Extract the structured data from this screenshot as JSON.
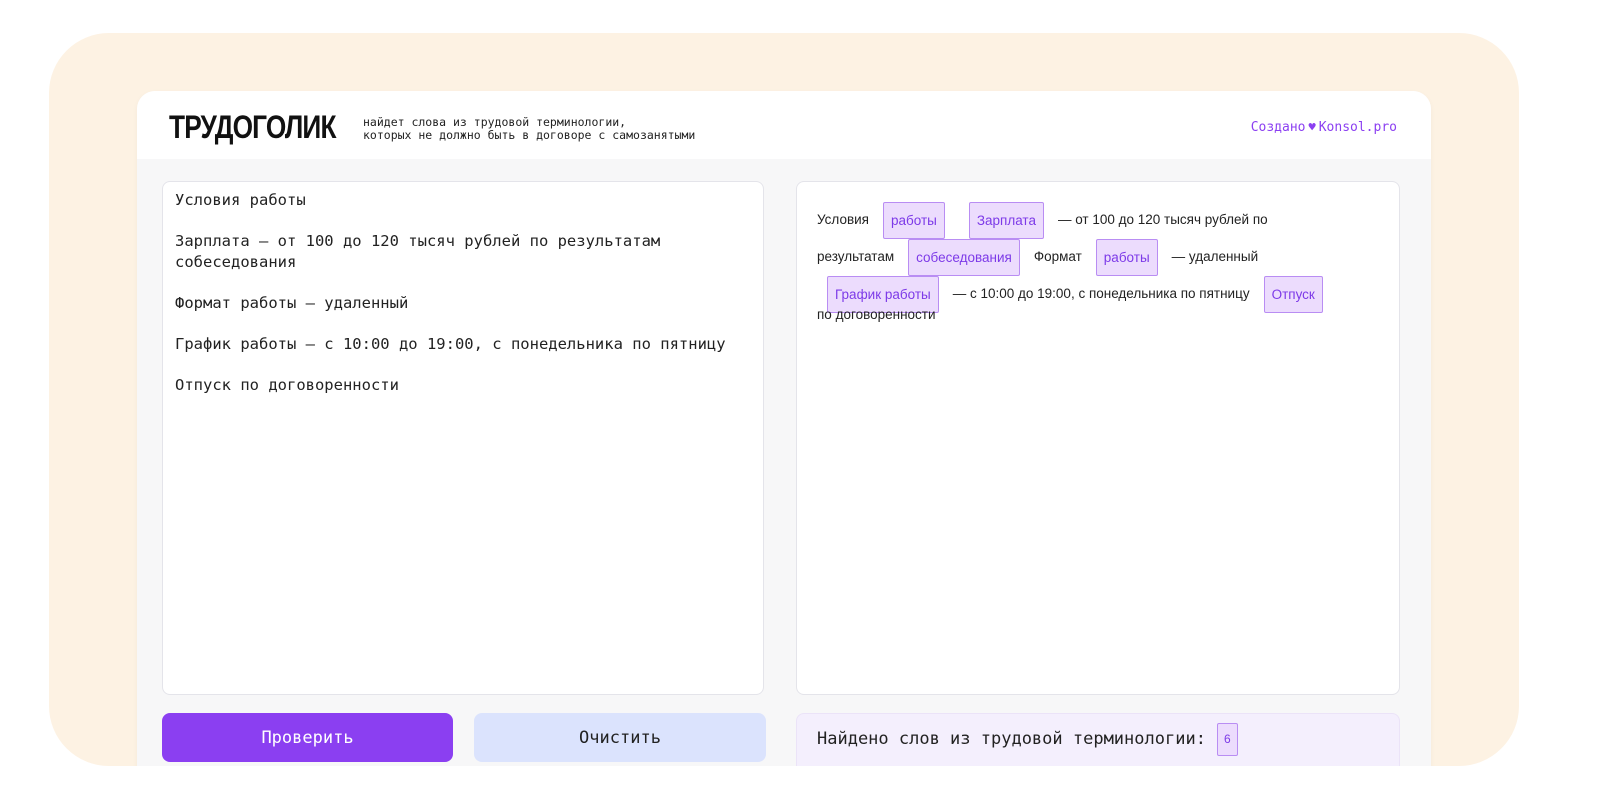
{
  "header": {
    "logo": "ТРУДОГОЛИК",
    "tagline_line1": "найдет слова из трудовой терминологии,",
    "tagline_line2": "которых не должно быть в договоре с самозанятыми",
    "credit_prefix": "Создано",
    "credit_link": "Konsol.pro"
  },
  "editor": {
    "paragraphs": [
      "Условия работы",
      "Зарплата — от 100 до 120 тысяч рублей по результатам собеседования",
      "Формат работы — удаленный",
      "График работы — с 10:00 до 19:00, с понедельника по пятницу",
      "Отпуск по договоренности"
    ]
  },
  "preview": {
    "t1": "Условия",
    "h1": "работы",
    "h2": "Зарплата",
    "t2": "— от 100 до 120 тысяч рублей по",
    "t3": "результатам",
    "h3": "собеседования",
    "t4": "Формат",
    "h4": "работы",
    "t5": "— удаленный",
    "h5": "График работы",
    "t6": "— с 10:00 до 19:00, с понедельника по пятницу",
    "h6": "Отпуск",
    "t7": "по договоренности"
  },
  "actions": {
    "check_label": "Проверить",
    "clear_label": "Очистить"
  },
  "result": {
    "label": "Найдено слов из трудовой терминологии:",
    "count": "6"
  },
  "colors": {
    "accent": "#8b3ff1",
    "highlight_bg": "#ecdcfd",
    "highlight_border": "#b98df3",
    "secondary_button": "#dbe3fd",
    "frame_bg": "#fdf2e3"
  }
}
